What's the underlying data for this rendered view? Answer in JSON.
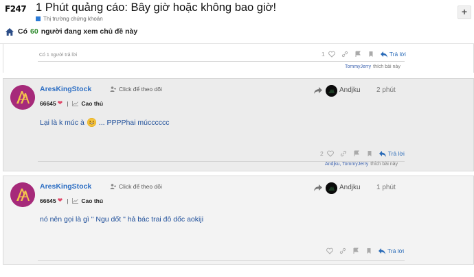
{
  "header": {
    "logo_main": "F247",
    "logo_sub": "",
    "title": "1 Phút quảng cáo: Bây giờ hoặc không bao giờ!",
    "category": "Thị trường chứng khoán",
    "viewers_prefix": "Có",
    "viewers_count": "60",
    "viewers_suffix": "người đang xem chủ đề này",
    "plus_label": "+"
  },
  "previous_post": {
    "reply_count_text": "Có 1 người trả lời",
    "likes": "1",
    "reply_label": "Trả lời",
    "liked_by_names": "TommyJerry",
    "liked_by_suffix": "thích bài này"
  },
  "posts": [
    {
      "username": "AresKingStock",
      "follow_label": "Click để theo dõi",
      "score": "66645",
      "rank": "Cao thủ",
      "reply_to_user": "Andjku",
      "time": "2 phút",
      "content_before": "Lại là k múc à",
      "content_after": "... PPPPhai múcccccc",
      "likes": "2",
      "reply_label": "Trả lời",
      "liked_by_names": "Andjku, TommyJerry",
      "liked_by_suffix": "thích bài này"
    },
    {
      "username": "AresKingStock",
      "follow_label": "Click để theo dõi",
      "score": "66645",
      "rank": "Cao thủ",
      "reply_to_user": "Andjku",
      "time": "1 phút",
      "content": "nó nên gọi là gì \" Ngu dốt \" hả bác trai đô dốc aokiji",
      "reply_label": "Trả lời"
    }
  ],
  "colors": {
    "accent_blue": "#2e6fc4",
    "viewer_green": "#2e8b2e",
    "avatar_magenta": "#a62a7a",
    "heart_pink": "#e04a6a",
    "category_blue": "#2c7bd6"
  },
  "icons": [
    "home-icon",
    "heart-icon",
    "link-icon",
    "flag-icon",
    "bookmark-icon",
    "reply-icon",
    "share-icon",
    "user-plus-icon",
    "trend-icon"
  ]
}
